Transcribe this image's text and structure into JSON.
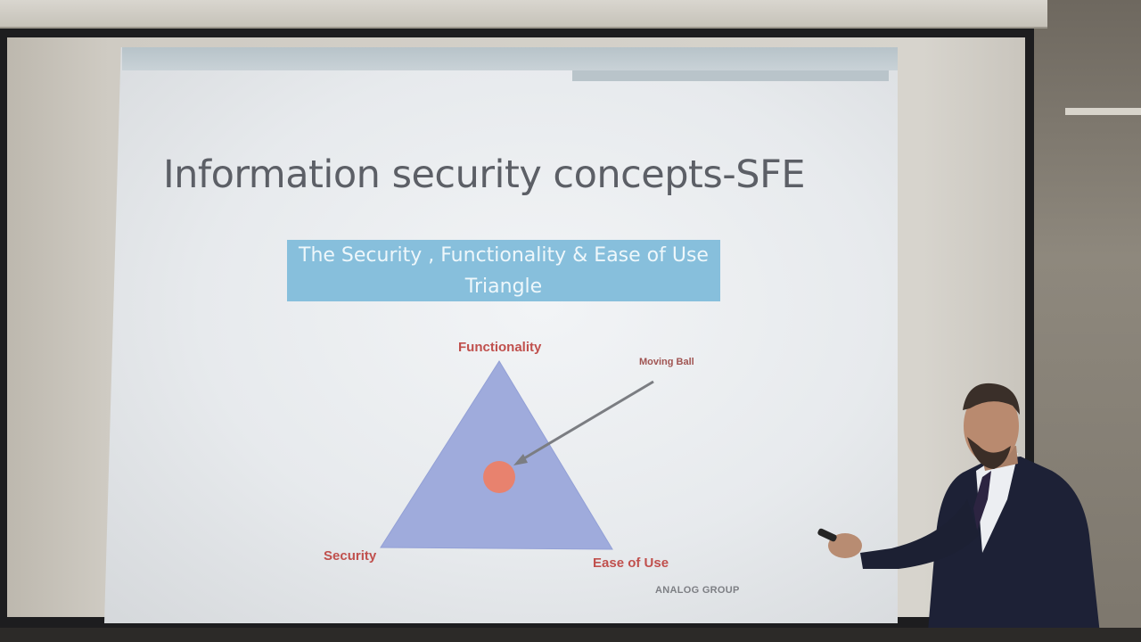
{
  "slide": {
    "title": "Information security concepts-SFE",
    "subtitle": "The Security , Functionality & Ease of Use Triangle",
    "diagram": {
      "top_vertex": "Functionality",
      "left_vertex": "Security",
      "right_vertex": "Ease of Use",
      "callout": "Moving Ball"
    },
    "watermark": "ANALOG GROUP"
  },
  "colors": {
    "triangle_fill": "#9fabdc",
    "ball_fill": "#e8826e",
    "label_red": "#c0504d",
    "subtitle_bg": "#87bfdc"
  }
}
